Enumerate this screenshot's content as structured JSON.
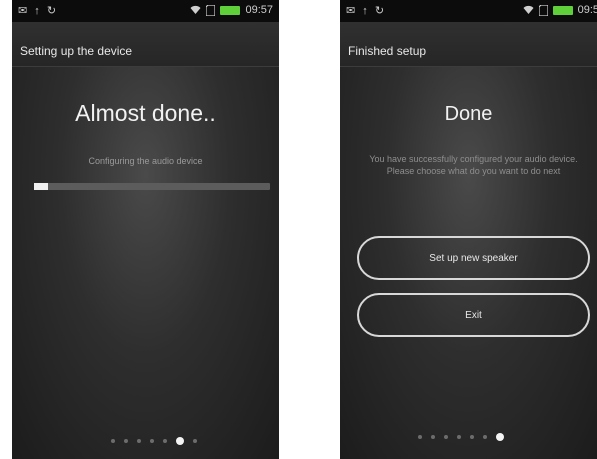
{
  "left_screen": {
    "status": {
      "left_icons": "✉ ↑ ↻",
      "time": "09:57"
    },
    "title": "Setting up the device",
    "heading": "Almost done..",
    "subtext": "Configuring the audio device",
    "progress": 0.06,
    "page_dots": {
      "count": 7,
      "active": 5
    }
  },
  "right_screen": {
    "status": {
      "left_icons": "✉ ↑ ↻",
      "time": "09:5"
    },
    "title": "Finished setup",
    "heading": "Done",
    "message": "You have successfully configured your audio device. Please choose what do you want to do next",
    "buttons": {
      "setup_label": "Set up new speaker",
      "exit_label": "Exit"
    },
    "page_dots": {
      "count": 7,
      "active": 6
    }
  },
  "colors": {
    "battery": "#5fcf3a",
    "background": "#2a2a2a",
    "accent": "#f0f0f0"
  },
  "icons": [
    "wifi-icon",
    "battery-icon",
    "sd-card-icon"
  ]
}
